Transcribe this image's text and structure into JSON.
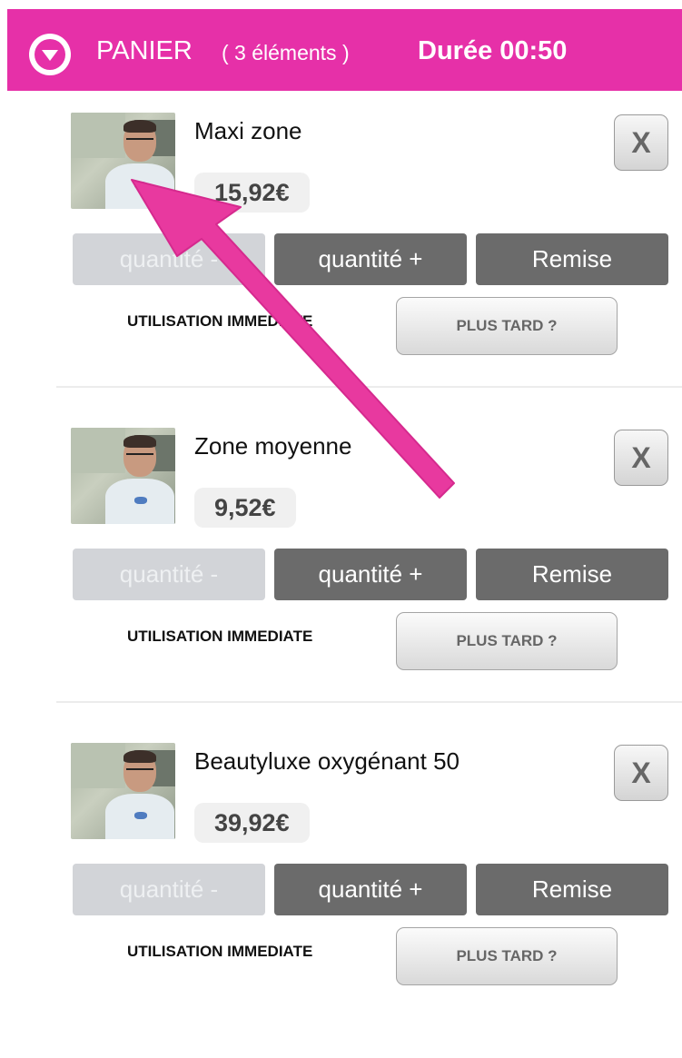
{
  "header": {
    "title": "PANIER",
    "count": "( 3 éléments )",
    "duration": "Durée 00:50",
    "accent_color": "#e630a8",
    "toggle_icon": "chevron-down-circle-icon"
  },
  "items": [
    {
      "name": "Maxi zone",
      "price": "15,92€",
      "close_label": "X",
      "qty_minus_label": "quantité -",
      "qty_plus_label": "quantité +",
      "discount_label": "Remise",
      "usage_label": "UTILISATION IMMEDIATE",
      "later_label": "PLUS TARD ?"
    },
    {
      "name": "Zone moyenne",
      "price": "9,52€",
      "close_label": "X",
      "qty_minus_label": "quantité -",
      "qty_plus_label": "quantité +",
      "discount_label": "Remise",
      "usage_label": "UTILISATION IMMEDIATE",
      "later_label": "PLUS TARD ?"
    },
    {
      "name": "Beautyluxe oxygénant 50",
      "price": "39,92€",
      "close_label": "X",
      "qty_minus_label": "quantité -",
      "qty_plus_label": "quantité +",
      "discount_label": "Remise",
      "usage_label": "UTILISATION IMMEDIATE",
      "later_label": "PLUS TARD ?"
    }
  ],
  "annotation": {
    "arrow_color": "#e8399f",
    "arrow_icon": "pointer-arrow-icon"
  }
}
